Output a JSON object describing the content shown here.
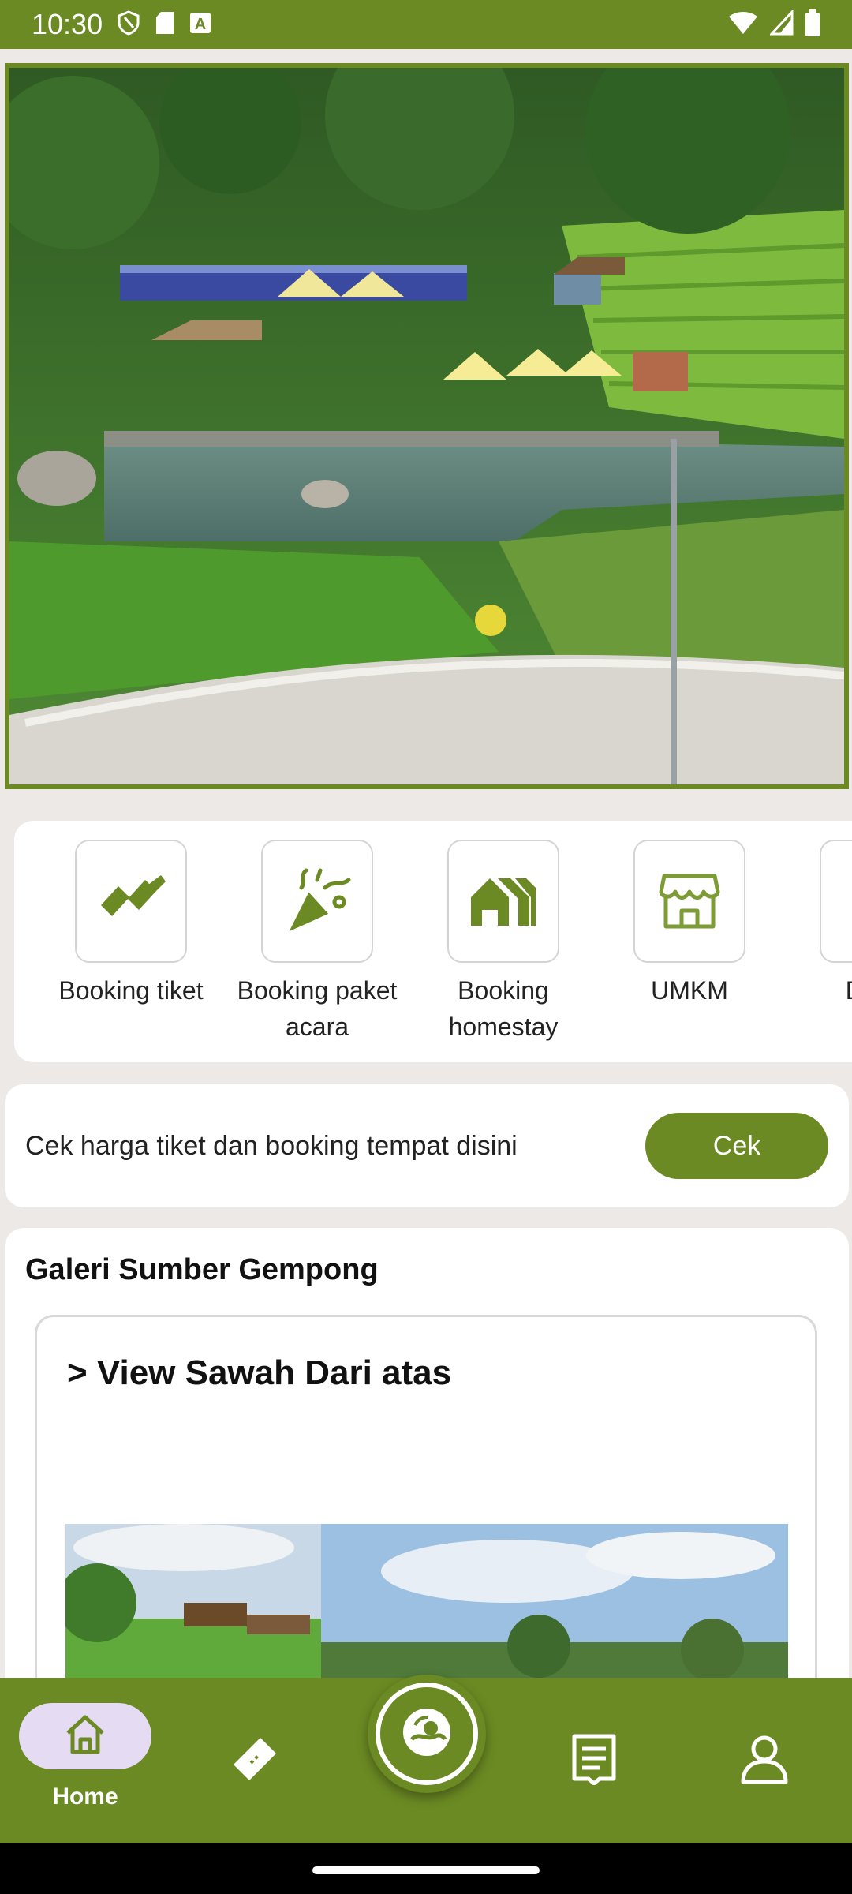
{
  "status_bar": {
    "time": "10:30",
    "icons_left": [
      "shield-icon",
      "sd-card-icon",
      "font-a-icon"
    ],
    "icons_right": [
      "wifi-icon",
      "signal-icon",
      "battery-icon"
    ]
  },
  "hero": {
    "image_desc_icon": "hero-photo"
  },
  "menu": {
    "items": [
      {
        "label": "Booking tiket",
        "icon": "ticket-icon"
      },
      {
        "label": "Booking paket acara",
        "icon": "party-icon"
      },
      {
        "label": "Booking homestay",
        "icon": "homestay-icon"
      },
      {
        "label": "UMKM",
        "icon": "store-icon"
      },
      {
        "label": "Dafta",
        "icon": "list-icon"
      }
    ]
  },
  "cek": {
    "text": "Cek harga tiket dan booking tempat disini",
    "button_label": "Cek"
  },
  "gallery": {
    "title": "Galeri Sumber Gempong",
    "card_title": "> View Sawah Dari atas"
  },
  "bottom_nav": {
    "items": [
      {
        "label": "Home",
        "icon": "home-icon",
        "active": true
      },
      {
        "label": "",
        "icon": "ticket-nav-icon"
      },
      {
        "label": "",
        "icon": "scan-icon"
      },
      {
        "label": "",
        "icon": "receipt-icon"
      },
      {
        "label": "",
        "icon": "person-icon"
      }
    ]
  },
  "colors": {
    "brand": "#6b8a23",
    "active_pill": "#e5dbf3",
    "page_bg": "#ece9e7"
  }
}
